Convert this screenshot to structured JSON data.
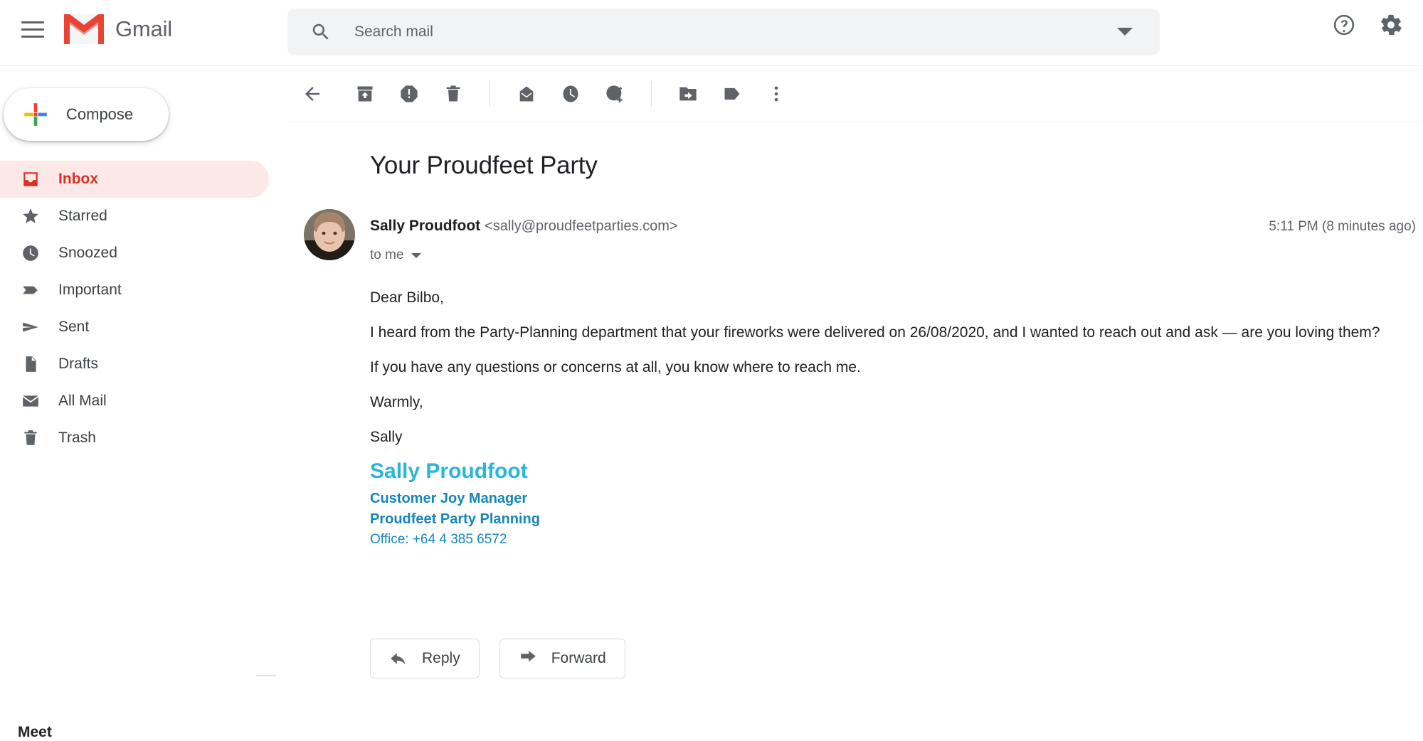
{
  "app": {
    "name": "Gmail",
    "menu_icon": "hamburger-icon"
  },
  "search": {
    "placeholder": "Search mail",
    "value": "",
    "icon": "search-icon",
    "options_caret": "chevron-down-icon"
  },
  "header_actions": [
    {
      "name": "support-icon",
      "label": "Support"
    },
    {
      "name": "settings-icon",
      "label": "Settings"
    }
  ],
  "sidebar": {
    "compose_label": "Compose",
    "items": [
      {
        "label": "Inbox",
        "icon": "inbox-icon",
        "active": true
      },
      {
        "label": "Starred",
        "icon": "star-icon",
        "active": false
      },
      {
        "label": "Snoozed",
        "icon": "clock-icon",
        "active": false
      },
      {
        "label": "Important",
        "icon": "important-icon",
        "active": false
      },
      {
        "label": "Sent",
        "icon": "send-icon",
        "active": false
      },
      {
        "label": "Drafts",
        "icon": "draft-icon",
        "active": false
      },
      {
        "label": "All Mail",
        "icon": "mail-icon",
        "active": false
      },
      {
        "label": "Trash",
        "icon": "trash-icon",
        "active": false
      }
    ],
    "meet_label": "Meet"
  },
  "toolbar": [
    {
      "name": "back-icon",
      "label": "Back to Inbox"
    },
    {
      "name": "archive-icon",
      "label": "Archive"
    },
    {
      "name": "report-spam-icon",
      "label": "Report spam"
    },
    {
      "name": "delete-icon",
      "label": "Delete"
    },
    {
      "name": "mark-unread-icon",
      "label": "Mark as unread"
    },
    {
      "name": "snooze-icon",
      "label": "Snooze"
    },
    {
      "name": "add-to-tasks-icon",
      "label": "Add to Tasks"
    },
    {
      "name": "move-to-icon",
      "label": "Move to"
    },
    {
      "name": "labels-icon",
      "label": "Labels"
    },
    {
      "name": "more-options-icon",
      "label": "More"
    }
  ],
  "email": {
    "subject": "Your Proudfeet Party",
    "sender_name": "Sally Proudfoot",
    "sender_email": "<sally@proudfeetparties.com>",
    "recipient": "to me",
    "timestamp": "5:11 PM (8 minutes ago)",
    "body": [
      "Dear Bilbo,",
      "I heard from the Party-Planning department that your fireworks were delivered on 26/08/2020, and I wanted to reach out and ask — are you loving them?",
      "If you have any questions or concerns at all, you know where to reach me.",
      "Warmly,",
      "Sally"
    ],
    "signature": {
      "name": "Sally Proudfoot",
      "role": "Customer Joy Manager",
      "company": "Proudfeet Party Planning",
      "office": "Office: +64 4 385 6572"
    },
    "actions": [
      {
        "label": "Reply",
        "icon": "reply-icon"
      },
      {
        "label": "Forward",
        "icon": "forward-icon"
      }
    ]
  },
  "colors": {
    "gmail_red": "#d93025",
    "active_pill": "#fce8e6",
    "signature_name": "#29b6d8",
    "signature_text": "#1487b8",
    "icon_grey": "#5f6368"
  }
}
